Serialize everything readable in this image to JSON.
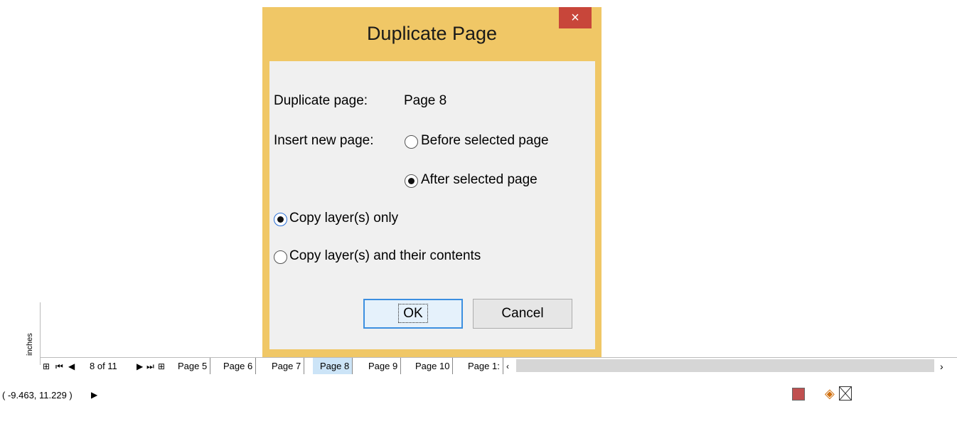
{
  "dialog": {
    "title": "Duplicate Page",
    "close_glyph": "×",
    "duplicate_label": "Duplicate page:",
    "duplicate_value": "Page 8",
    "insert_label": "Insert new page:",
    "options": {
      "before": "Before selected page",
      "after": "After selected page",
      "copy_layers_only": "Copy layer(s) only",
      "copy_layers_contents": "Copy layer(s) and their contents"
    },
    "ok_label": "OK",
    "cancel_label": "Cancel"
  },
  "ruler": {
    "units": "inches"
  },
  "pagebar": {
    "counter": "8 of 11",
    "tabs": [
      "Page 5",
      "Page 6",
      "Page 7",
      "Page 8",
      "Page 9",
      "Page 10",
      "Page 1:"
    ],
    "active": "Page 8"
  },
  "status": {
    "coords": "( -9.463, 11.229 )"
  },
  "icons": [
    "first-page-icon",
    "prev-page-icon",
    "next-page-icon",
    "last-page-icon",
    "add-page-icon",
    "fill-icon",
    "no-fill-icon"
  ]
}
